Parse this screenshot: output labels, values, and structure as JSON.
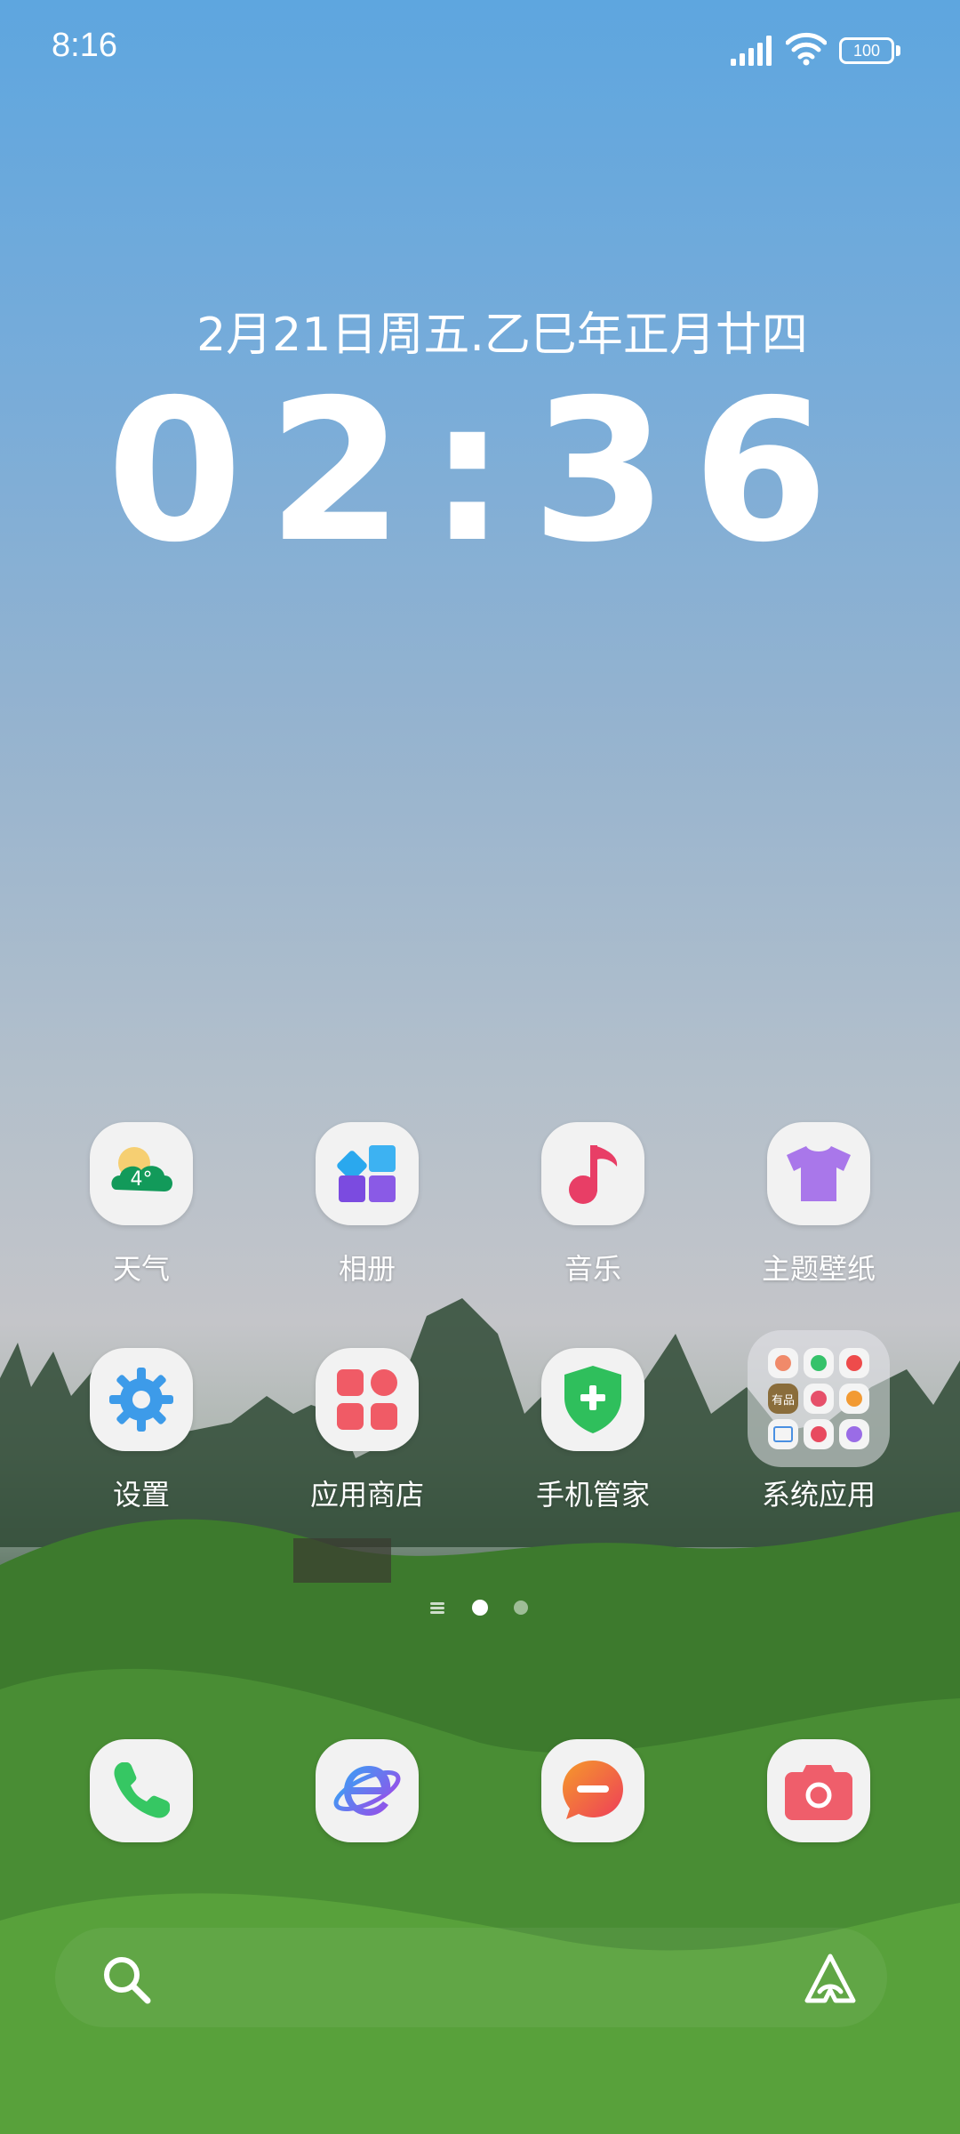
{
  "status_bar": {
    "time": "8:16",
    "battery": "100",
    "icons": [
      "signal-icon",
      "wifi-icon",
      "battery-icon"
    ]
  },
  "widget": {
    "date": "2月21日周五.乙巳年正月廿四",
    "time": "02:36"
  },
  "apps": [
    {
      "label": "天气",
      "icon": "weather-icon",
      "temp": "4°"
    },
    {
      "label": "相册",
      "icon": "gallery-icon"
    },
    {
      "label": "音乐",
      "icon": "music-icon"
    },
    {
      "label": "主题壁纸",
      "icon": "theme-icon"
    },
    {
      "label": "设置",
      "icon": "settings-gear-icon"
    },
    {
      "label": "应用商店",
      "icon": "app-store-icon"
    },
    {
      "label": "手机管家",
      "icon": "phone-manager-shield-icon"
    },
    {
      "label": "系统应用",
      "icon": "folder-icon"
    }
  ],
  "folder_mini_apps": [
    "有品"
  ],
  "pages": {
    "count": 2,
    "current": 1
  },
  "dock": [
    {
      "icon": "phone-icon"
    },
    {
      "icon": "browser-icon"
    },
    {
      "icon": "messages-icon"
    },
    {
      "icon": "camera-icon"
    }
  ],
  "bottom_bar": {
    "left_icon": "search-icon",
    "right_icon": "assistant-icon"
  },
  "colors": {
    "weather_cloud": "#129a5a",
    "gallery_blue": "#2aa8ee",
    "gallery_purple": "#7b4be0",
    "music_red": "#e83e66",
    "theme_purple": "#a977ea",
    "settings_blue": "#3d9be9",
    "store_red": "#f05b66",
    "shield_green": "#2fbf5c",
    "phone_green": "#36c763",
    "messages_orange": "#f0652f",
    "camera_red": "#ef5e6b"
  }
}
